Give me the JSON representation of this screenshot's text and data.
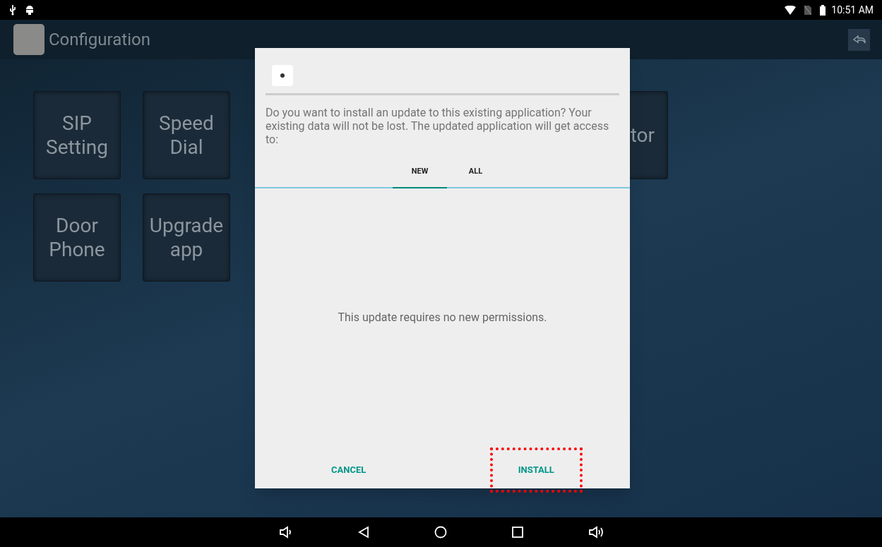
{
  "status_bar": {
    "time": "10:51 AM"
  },
  "app_bar": {
    "title": "Configuration"
  },
  "tiles": [
    {
      "kind": "full",
      "label": "SIP Setting"
    },
    {
      "kind": "full",
      "label": "Speed Dial"
    },
    {
      "kind": "hidden"
    },
    {
      "kind": "hidden"
    },
    {
      "kind": "hidden"
    },
    {
      "kind": "clipped",
      "label": "tor"
    },
    {
      "kind": "full",
      "label": "Door Phone"
    },
    {
      "kind": "full",
      "label": "Upgrade app"
    }
  ],
  "dialog": {
    "message": "Do you want to install an update to this existing application? Your existing data will not be lost. The updated application will get access to:",
    "tabs": [
      {
        "label": "NEW",
        "selected": true
      },
      {
        "label": "ALL",
        "selected": false
      }
    ],
    "body": "This update requires no new permissions.",
    "buttons": [
      {
        "label": "CANCEL",
        "highlighted": false
      },
      {
        "label": "INSTALL",
        "highlighted": true
      }
    ]
  }
}
